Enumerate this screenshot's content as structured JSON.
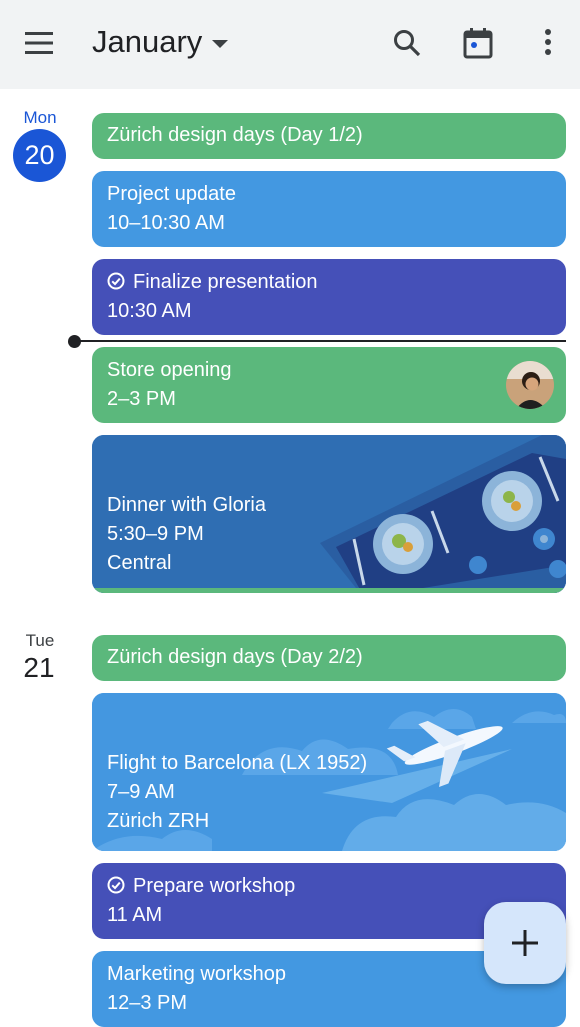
{
  "header": {
    "month": "January",
    "icons": [
      "menu-icon",
      "chevron-down-icon",
      "search-icon",
      "calendar-today-icon",
      "more-vert-icon"
    ]
  },
  "colors": {
    "accent": "#1a56d6",
    "green": "#5bb87c",
    "blue": "#4398e1",
    "indigo": "#4550b8"
  },
  "days": [
    {
      "dow": "Mon",
      "date": "20"
    },
    {
      "dow": "Tue",
      "date": "21"
    }
  ],
  "events": {
    "zurich1": {
      "title": "Zürich design days (Day 1/2)"
    },
    "project": {
      "title": "Project update",
      "time": "10–10:30 AM"
    },
    "finalize": {
      "title": "Finalize presentation",
      "time": "10:30 AM"
    },
    "store": {
      "title": "Store opening",
      "time": "2–3 PM"
    },
    "dinner": {
      "title": "Dinner with Gloria",
      "time": "5:30–9 PM",
      "location": "Central"
    },
    "zurich2": {
      "title": "Zürich design days (Day 2/2)"
    },
    "flight": {
      "title": "Flight to Barcelona (LX 1952)",
      "time": "7–9 AM",
      "location": "Zürich ZRH"
    },
    "workshop": {
      "title": "Prepare workshop",
      "time": "11 AM"
    },
    "marketing": {
      "title": "Marketing workshop",
      "time": "12–3 PM"
    }
  },
  "fab": {
    "icon": "plus-icon"
  }
}
